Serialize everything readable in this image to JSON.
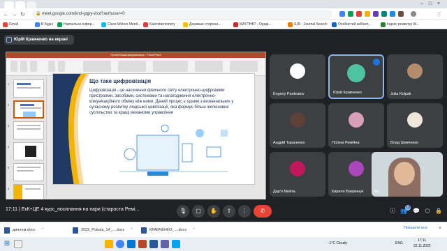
{
  "browser": {
    "url": "meet.google.com/knd-gqpy-wcd?authuser=0",
    "bookmarks": [
      "Gmail",
      "В Будні",
      "Навчально-інфор...",
      "Cisco Webex Meeti...",
      "Kalendarnomery",
      "Докавше сторінка...",
      "МАІ ПНБТ - Ориді...",
      "SJR - Journal Search",
      "Особистий кабінет...",
      "Індекс розвитку Ж..."
    ]
  },
  "meet": {
    "presenter_label": "Юрій Кравченко на екрані",
    "time": "17:11",
    "meeting_title": "ЕкК+ЦЕ 4 курс_посилання на пари (староста Ремі...",
    "badge_count": "13",
    "participants": [
      {
        "name": "Evgeny Pankratov",
        "active": false,
        "speaking": false
      },
      {
        "name": "Юрій Кравченко",
        "active": true,
        "speaking": true
      },
      {
        "name": "Julia Kolpak",
        "active": false,
        "speaking": false
      },
      {
        "name": "Андрій Тараненко",
        "active": false,
        "speaking": false
      },
      {
        "name": "Поліна Ремі4на",
        "active": false,
        "speaking": false
      },
      {
        "name": "Влад Шевченко",
        "active": false,
        "speaking": false
      },
      {
        "name": "Дар'я Мейта",
        "active": false,
        "speaking": false
      },
      {
        "name": "Кирило Вавріннук",
        "active": false,
        "speaking": false
      },
      {
        "name": "Ви",
        "active": false,
        "speaking": false
      }
    ]
  },
  "ppt": {
    "title": "ПрезентаціяЦифровізація - PowerPoint",
    "slide_title": "Що таке цифровізація",
    "slide_body": "Цифровізація - це насичення фізичного світу електронно-цифровими пристроями, засобами, системами та налагодження електронно-комунікаційного обміну між ними. Даний процес є одним з визначальних у сучасному розвитку людської цивілізації, яка формує більш інклюзивне суспільство та кращі механізми управління",
    "thumb_numbers": [
      "1",
      "2",
      "3",
      "4",
      "5",
      "6"
    ]
  },
  "downloads": {
    "items": [
      "диплом.docx",
      "2022_Poluda_14_....docx",
      "КРАВЧЕНКО_....docx"
    ],
    "show_all": "Показати все"
  },
  "taskbar": {
    "weather": "-1°C  Cloudy",
    "lang": "ENG",
    "time": "17:11",
    "date": "22.11.2022"
  }
}
